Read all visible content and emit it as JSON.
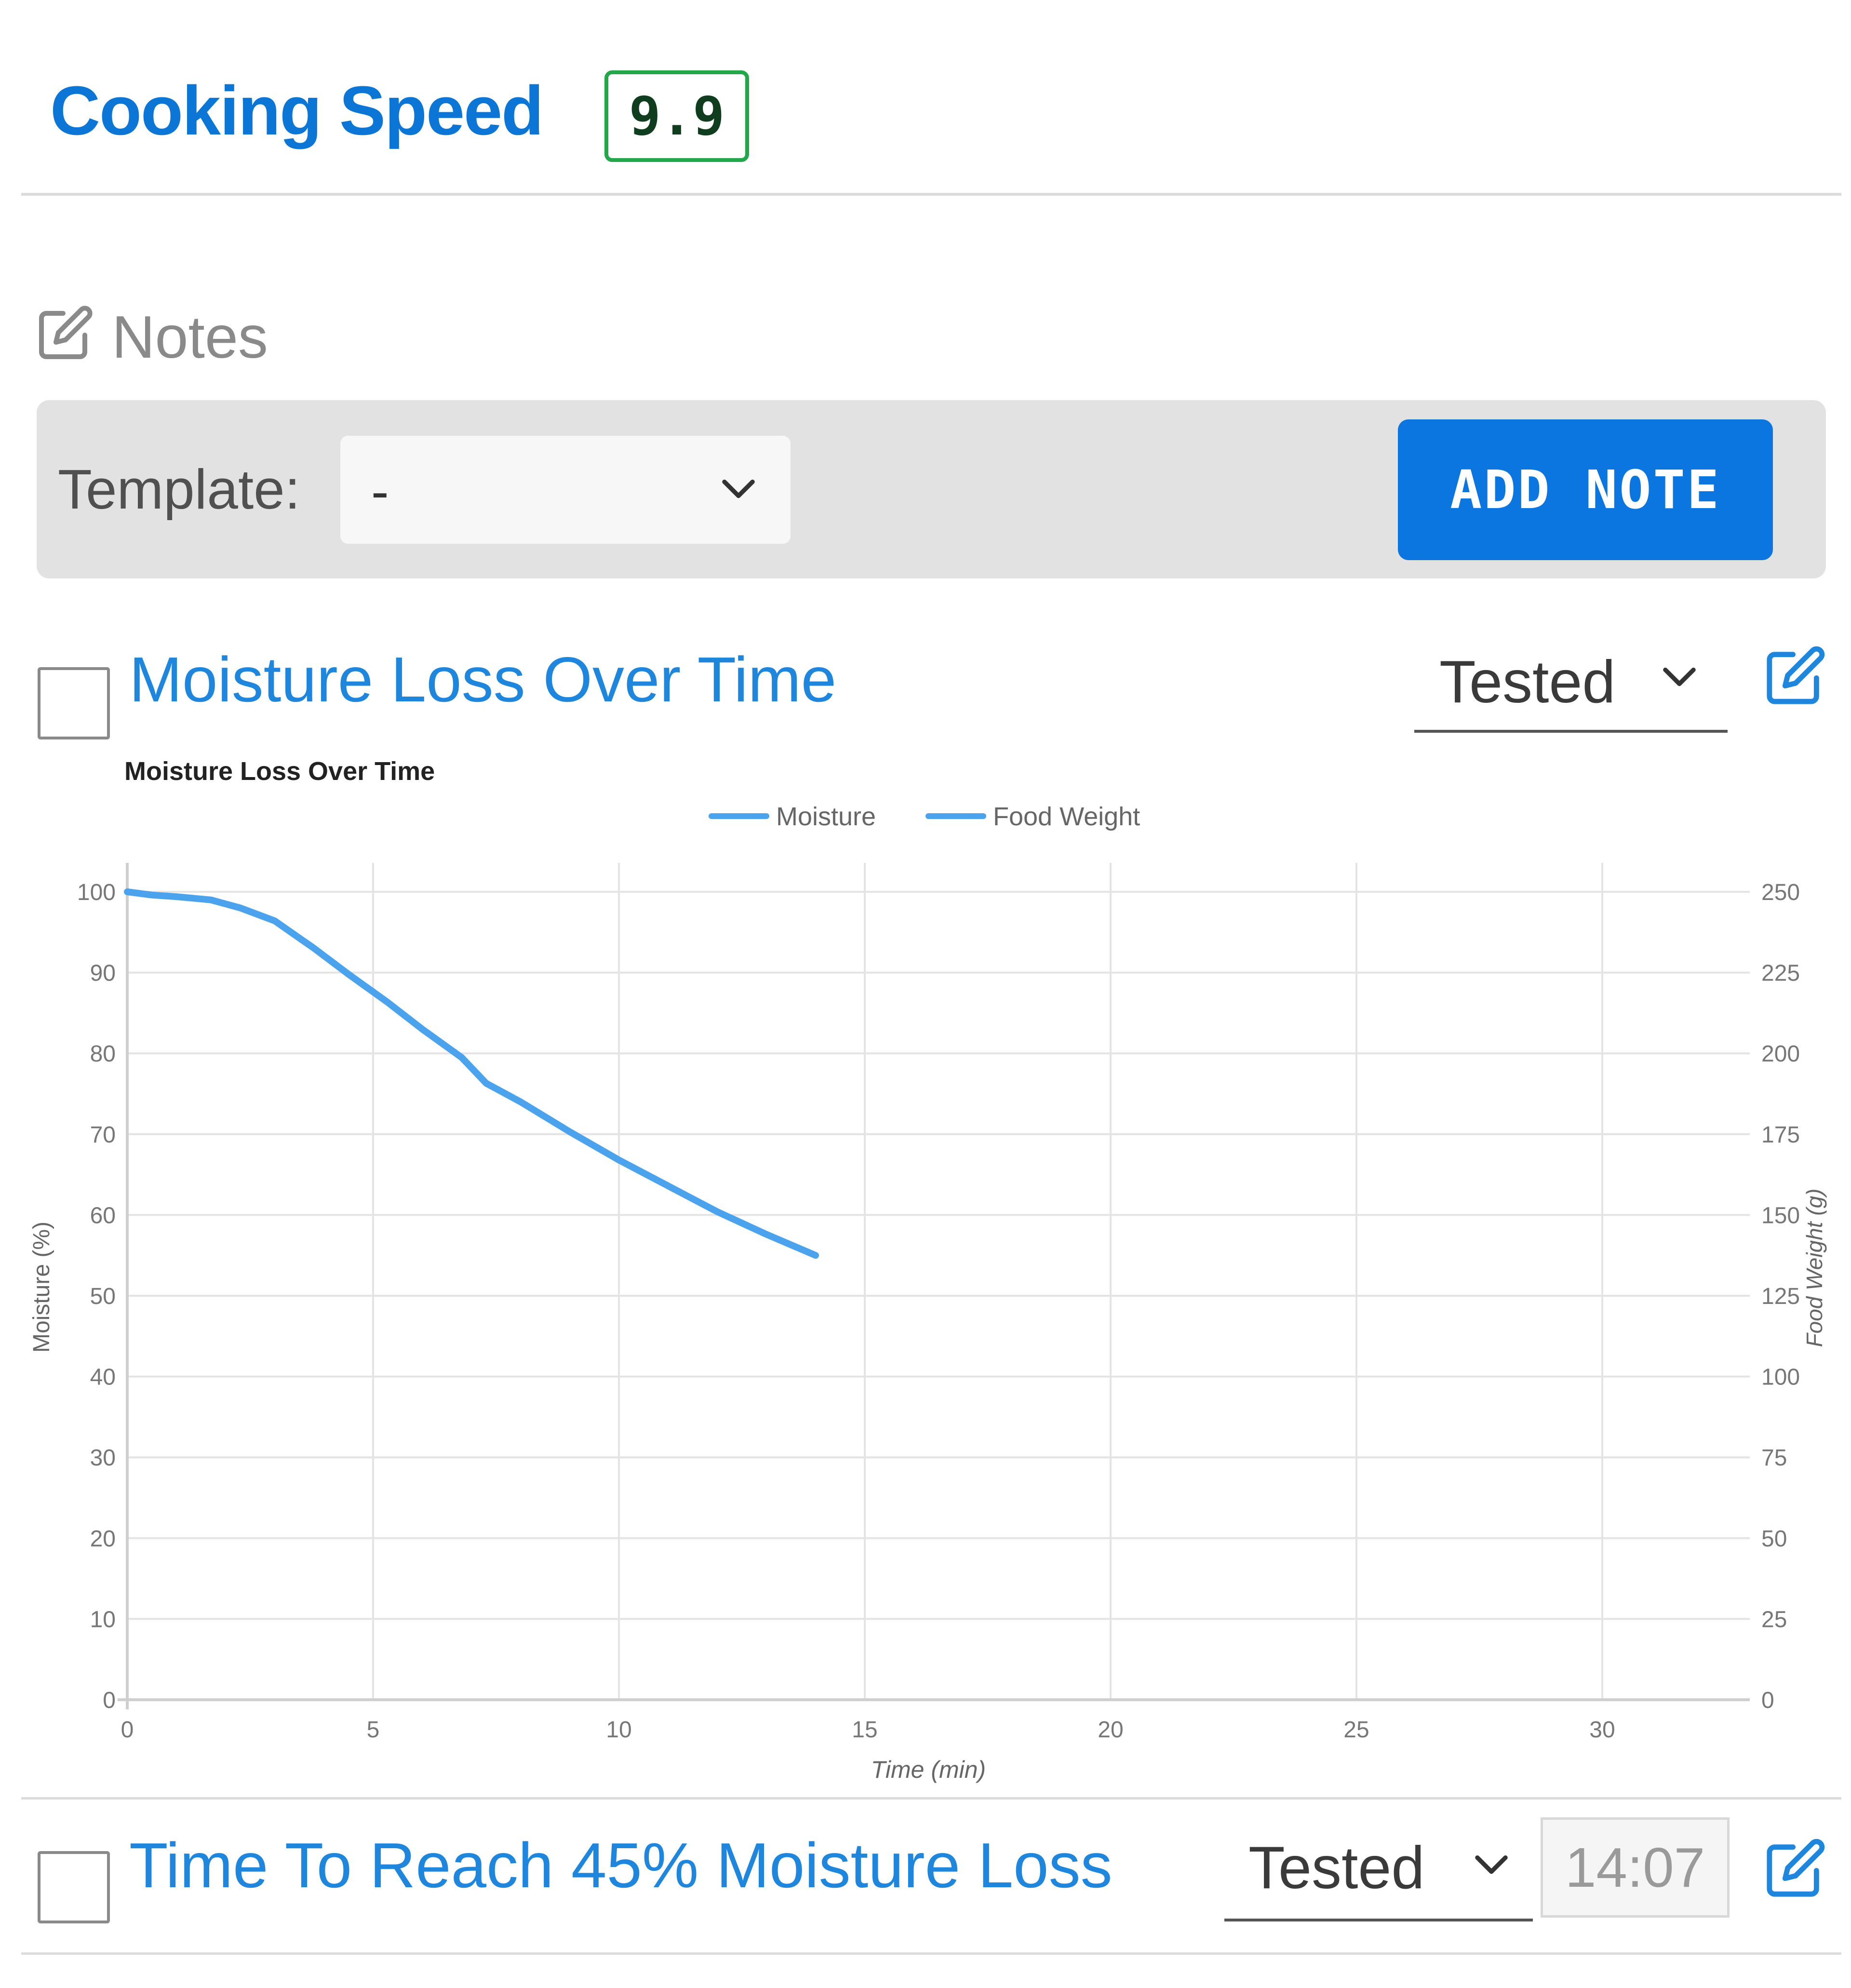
{
  "header": {
    "title": "Cooking Speed",
    "score": "9.9"
  },
  "notes": {
    "label": "Notes",
    "template_label": "Template:",
    "template_value": "-",
    "add_button": "ADD NOTE"
  },
  "items": [
    {
      "title": "Moisture Loss Over Time",
      "status": "Tested",
      "icon": "edit-icon"
    },
    {
      "title": "Time To Reach 45% Moisture Loss",
      "status": "Tested",
      "value": "14:07",
      "icon": "edit-icon"
    }
  ],
  "colors": {
    "accent": "#0b76e0",
    "title_blue": "#1f86dd",
    "score_border": "#22a84a",
    "series": "#4aa3ec"
  },
  "chart_data": {
    "type": "line",
    "title": "Moisture Loss Over Time",
    "xlabel": "Time (min)",
    "ylabel": "Moisture (%)",
    "y2label": "Food Weight (g)",
    "legend": [
      "Moisture",
      "Food Weight"
    ],
    "legend_position": "top-center",
    "grid": true,
    "xlim": [
      0,
      33
    ],
    "ylim": [
      0,
      100
    ],
    "y2lim": [
      0,
      250
    ],
    "x_ticks": [
      0,
      5,
      10,
      15,
      20,
      25,
      30
    ],
    "y_ticks": [
      0,
      10,
      20,
      30,
      40,
      50,
      60,
      70,
      80,
      90,
      100
    ],
    "y2_ticks": [
      0,
      25,
      50,
      75,
      100,
      125,
      150,
      175,
      200,
      225,
      250
    ],
    "series": [
      {
        "name": "Moisture",
        "x": [
          0,
          0.5,
          1,
          1.7,
          2.3,
          3,
          3.8,
          4.5,
          5.3,
          6,
          6.8,
          7.3,
          8,
          9,
          10,
          11,
          12,
          13,
          14
        ],
        "y": [
          100,
          99.6,
          99.4,
          99,
          98,
          96.4,
          93,
          89.8,
          86.3,
          83,
          79.5,
          76.3,
          74,
          70.3,
          66.8,
          63.6,
          60.4,
          57.6,
          55
        ]
      }
    ]
  }
}
